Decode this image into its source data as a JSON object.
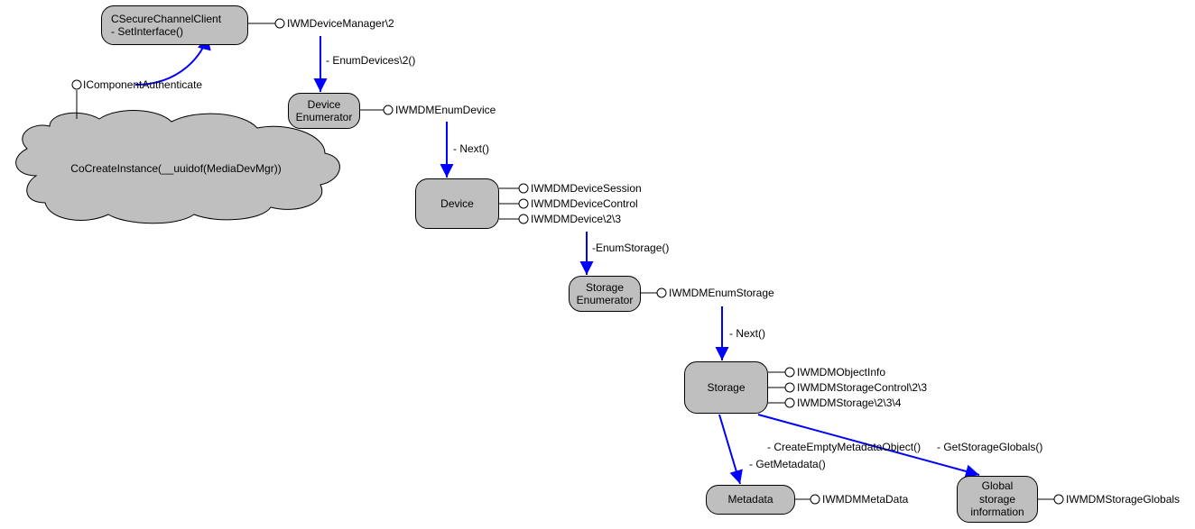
{
  "nodes": {
    "secureClient": {
      "line1": "CSecureChannelClient",
      "line2": "- SetInterface()"
    },
    "devEnum": {
      "line1": "Device",
      "line2": "Enumerator"
    },
    "device": "Device",
    "storEnum": {
      "line1": "Storage",
      "line2": "Enumerator"
    },
    "storage": "Storage",
    "metadata": "Metadata",
    "globalStor": {
      "line1": "Global",
      "line2": "storage",
      "line3": "information"
    }
  },
  "cloud": "CoCreateInstance(__uuidof(MediaDevMgr))",
  "iface": {
    "icompauth": "IComponentAuthenticate",
    "iwmdevmgr": "IWMDeviceManager\\2",
    "iwmenumdev": "IWMDMEnumDevice",
    "iwmdevsess": "IWMDMDeviceSession",
    "iwmdevctrl": "IWMDMDeviceControl",
    "iwmdev": "IWMDMDevice\\2\\3",
    "iwmenumstor": "IWMDMEnumStorage",
    "iwmobjinfo": "IWMDMObjectInfo",
    "iwmstorctrl": "IWMDMStorageControl\\2\\3",
    "iwmstor": "IWMDMStorage\\2\\3\\4",
    "iwmmeta": "IWMDMMetaData",
    "iwmstorglob": "IWMDMStorageGlobals"
  },
  "edges": {
    "enumDevices": "- EnumDevices\\2()",
    "next1": "- Next()",
    "enumStorage": "-EnumStorage()",
    "next2": "- Next()",
    "createMeta": "- CreateEmptyMetadataObject()",
    "getMeta": "- GetMetadata()",
    "getStorGlob": "- GetStorageGlobals()"
  }
}
